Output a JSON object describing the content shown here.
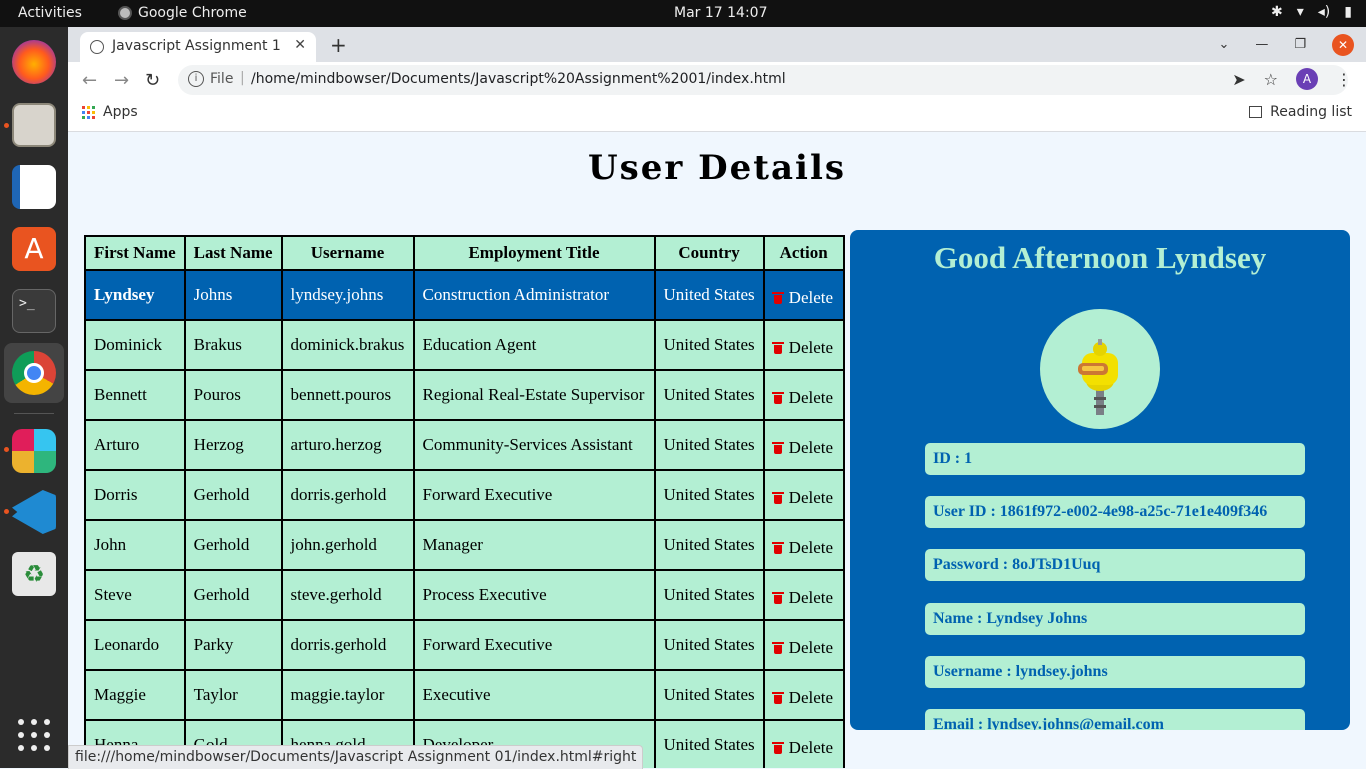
{
  "system_bar": {
    "activities": "Activities",
    "app_name": "Google Chrome",
    "clock": "Mar 17  14:07"
  },
  "dock": {
    "items": [
      "firefox-icon",
      "files-icon",
      "writer-icon",
      "app-center-icon",
      "terminal-icon",
      "chrome-icon",
      "slack-icon",
      "vscode-icon",
      "trash-icon"
    ],
    "accent": "#e95420"
  },
  "browser": {
    "tab_title": "Javascript Assignment 1",
    "omnibox_scheme": "File",
    "url": "/home/mindbowser/Documents/Javascript%20Assignment%2001/index.html",
    "avatar_letter": "A",
    "bookmarks_apps": "Apps",
    "reading_list": "Reading list",
    "status_url": "file:///home/mindbowser/Documents/Javascript Assignment 01/index.html#right"
  },
  "page": {
    "title": "User Details",
    "colors": {
      "mint": "#b3efd3",
      "blue": "#0062b0",
      "delete_red": "#e00000"
    }
  },
  "table": {
    "headers": [
      "First Name",
      "Last Name",
      "Username",
      "Employment Title",
      "Country",
      "Action"
    ],
    "delete_label": "Delete",
    "selected_row": 0,
    "rows": [
      {
        "first": "Lyndsey",
        "last": "Johns",
        "username": "lyndsey.johns",
        "title": "Construction Administrator",
        "country": "United States"
      },
      {
        "first": "Dominick",
        "last": "Brakus",
        "username": "dominick.brakus",
        "title": "Education Agent",
        "country": "United States"
      },
      {
        "first": "Bennett",
        "last": "Pouros",
        "username": "bennett.pouros",
        "title": "Regional Real-Estate Supervisor",
        "country": "United States"
      },
      {
        "first": "Arturo",
        "last": "Herzog",
        "username": "arturo.herzog",
        "title": "Community-Services Assistant",
        "country": "United States"
      },
      {
        "first": "Dorris",
        "last": "Gerhold",
        "username": "dorris.gerhold",
        "title": "Forward Executive",
        "country": "United States"
      },
      {
        "first": "John",
        "last": "Gerhold",
        "username": "john.gerhold",
        "title": "Manager",
        "country": "United States"
      },
      {
        "first": "Steve",
        "last": "Gerhold",
        "username": "steve.gerhold",
        "title": "Process Executive",
        "country": "United States"
      },
      {
        "first": "Leonardo",
        "last": "Parky",
        "username": "dorris.gerhold",
        "title": "Forward Executive",
        "country": "United States"
      },
      {
        "first": "Maggie",
        "last": "Taylor",
        "username": "maggie.taylor",
        "title": "Executive",
        "country": "United States"
      },
      {
        "first": "Henna",
        "last": "Gold",
        "username": "henna.gold",
        "title": "Developer",
        "country": "United States"
      }
    ]
  },
  "detail": {
    "greeting": "Good Afternoon Lyndsey",
    "avatar_icon": "robot-avatar-icon",
    "fields": [
      "ID : 1",
      "User ID : 1861f972-e002-4e98-a25c-71e1e409f346",
      "Password : 8oJTsD1Uuq",
      "Name : Lyndsey Johns",
      "Username : lyndsey.johns",
      "Email : lyndsey.johns@email.com"
    ]
  }
}
